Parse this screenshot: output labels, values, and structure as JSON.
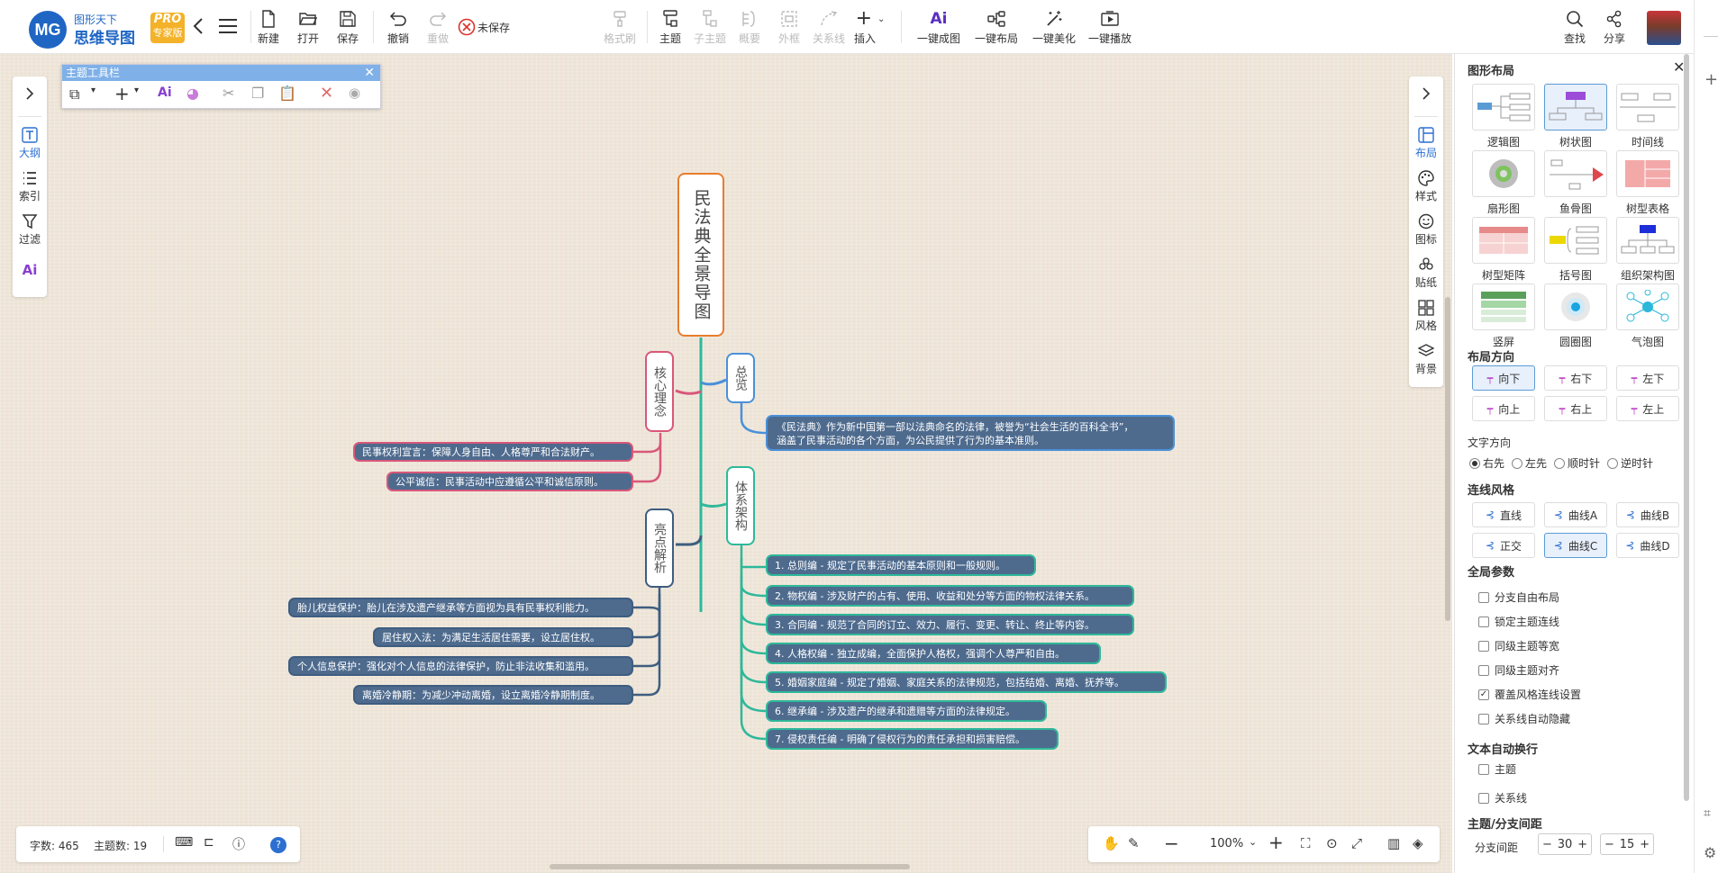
{
  "app": {
    "brand_top": "图形天下",
    "brand_main": "思维导图",
    "pro_badge": "PRO",
    "pro_sub": "专家版"
  },
  "toolbar": {
    "new": "新建",
    "open": "打开",
    "save": "保存",
    "undo": "撤销",
    "redo": "重做",
    "unsaved": "未保存",
    "format_brush": "格式刷",
    "topic": "主题",
    "subtopic": "子主题",
    "summary": "概要",
    "frame": "外框",
    "relation": "关系线",
    "insert": "插入",
    "ai_logo": "Ai",
    "ai_map": "一键成图",
    "one_layout": "一键布局",
    "one_beautify": "一键美化",
    "one_play": "一键播放",
    "find": "查找",
    "share": "分享"
  },
  "left_tools": {
    "outline": "大纲",
    "index": "索引",
    "filter": "过滤",
    "ai": "Ai"
  },
  "topic_toolbar": {
    "title": "主题工具栏",
    "ai": "Ai"
  },
  "right_tools": {
    "layout": "布局",
    "style": "样式",
    "icon": "图标",
    "sticker": "贴纸",
    "grid": "风格",
    "background": "背景"
  },
  "panel": {
    "title": "图形布局",
    "layouts": [
      {
        "name": "逻辑图",
        "selected": false
      },
      {
        "name": "树状图",
        "selected": true
      },
      {
        "name": "时间线",
        "selected": false
      },
      {
        "name": "扇形图",
        "selected": false
      },
      {
        "name": "鱼骨图",
        "selected": false
      },
      {
        "name": "树型表格",
        "selected": false
      },
      {
        "name": "树型矩阵",
        "selected": false
      },
      {
        "name": "括号图",
        "selected": false
      },
      {
        "name": "组织架构图",
        "selected": false
      },
      {
        "name": "竖屏",
        "selected": false
      },
      {
        "name": "圆圈图",
        "selected": false
      },
      {
        "name": "气泡图",
        "selected": false
      }
    ],
    "direction_title": "布局方向",
    "directions": [
      {
        "label": "向下",
        "selected": true
      },
      {
        "label": "右下",
        "selected": false
      },
      {
        "label": "左下",
        "selected": false
      },
      {
        "label": "向上",
        "selected": false
      },
      {
        "label": "右上",
        "selected": false
      },
      {
        "label": "左上",
        "selected": false
      }
    ],
    "text_dir_title": "文字方向",
    "text_dirs": [
      {
        "label": "右先",
        "selected": true
      },
      {
        "label": "左先",
        "selected": false
      },
      {
        "label": "顺时针",
        "selected": false
      },
      {
        "label": "逆时针",
        "selected": false
      }
    ],
    "line_style_title": "连线风格",
    "line_styles": [
      {
        "label": "直线",
        "selected": false
      },
      {
        "label": "曲线A",
        "selected": false
      },
      {
        "label": "曲线B",
        "selected": false
      },
      {
        "label": "正交",
        "selected": false
      },
      {
        "label": "曲线C",
        "selected": true
      },
      {
        "label": "曲线D",
        "selected": false
      }
    ],
    "global_title": "全局参数",
    "global_opts": [
      {
        "label": "分支自由布局",
        "checked": false
      },
      {
        "label": "锁定主题连线",
        "checked": false
      },
      {
        "label": "同级主题等宽",
        "checked": false
      },
      {
        "label": "同级主题对齐",
        "checked": false
      },
      {
        "label": "覆盖风格连线设置",
        "checked": true
      },
      {
        "label": "关系线自动隐藏",
        "checked": false
      }
    ],
    "wrap_title": "文本自动换行",
    "wrap_opts": [
      {
        "label": "主题",
        "checked": false
      },
      {
        "label": "关系线",
        "checked": false
      }
    ],
    "spacing_title": "主题/分支间距",
    "spacing_label": "分支间距",
    "spacing_v1": "30",
    "spacing_v2": "15"
  },
  "status": {
    "words": "字数: 465",
    "topics": "主题数: 19"
  },
  "zoom": {
    "level": "100%"
  },
  "map": {
    "root": "民法典全景导图",
    "core": "核心理念",
    "overview": "总览",
    "system": "体系架构",
    "highlights": "亮点解析",
    "overview_text_1": "《民法典》作为新中国第一部以法典命名的法律，被誉为“社会生活的百科全书”，",
    "overview_text_2": "涵盖了民事活动的各个方面，为公民提供了行为的基本准则。",
    "core_items": [
      "民事权利宣言：保障人身自由、人格尊严和合法财产。",
      "公平诚信：民事活动中应遵循公平和诚信原则。"
    ],
    "highlight_items": [
      "胎儿权益保护：胎儿在涉及遗产继承等方面视为具有民事权利能力。",
      "居住权入法：为满足生活居住需要，设立居住权。",
      "个人信息保护：强化对个人信息的法律保护，防止非法收集和滥用。",
      "离婚冷静期：为减少冲动离婚，设立离婚冷静期制度。"
    ],
    "system_items": [
      "1. 总则编 - 规定了民事活动的基本原则和一般规则。",
      "2. 物权编 - 涉及财产的占有、使用、收益和处分等方面的物权法律关系。",
      "3. 合同编 - 规范了合同的订立、效力、履行、变更、转让、终止等内容。",
      "4. 人格权编 - 独立成编，全面保护人格权，强调个人尊严和自由。",
      "5. 婚姻家庭编 - 规定了婚姻、家庭关系的法律规范，包括结婚、离婚、抚养等。",
      "6. 继承编 - 涉及遗产的继承和遗赠等方面的法律规定。",
      "7. 侵权责任编 - 明确了侵权行为的责任承担和损害赔偿。"
    ]
  },
  "colors": {
    "accent": "#5b9bd5",
    "root_border": "#e87c2d",
    "core": "#d9577a",
    "overview": "#4a90d9",
    "system": "#2fb89a",
    "highlights": "#3e5d80",
    "node_fill": "#4e6b8e"
  }
}
